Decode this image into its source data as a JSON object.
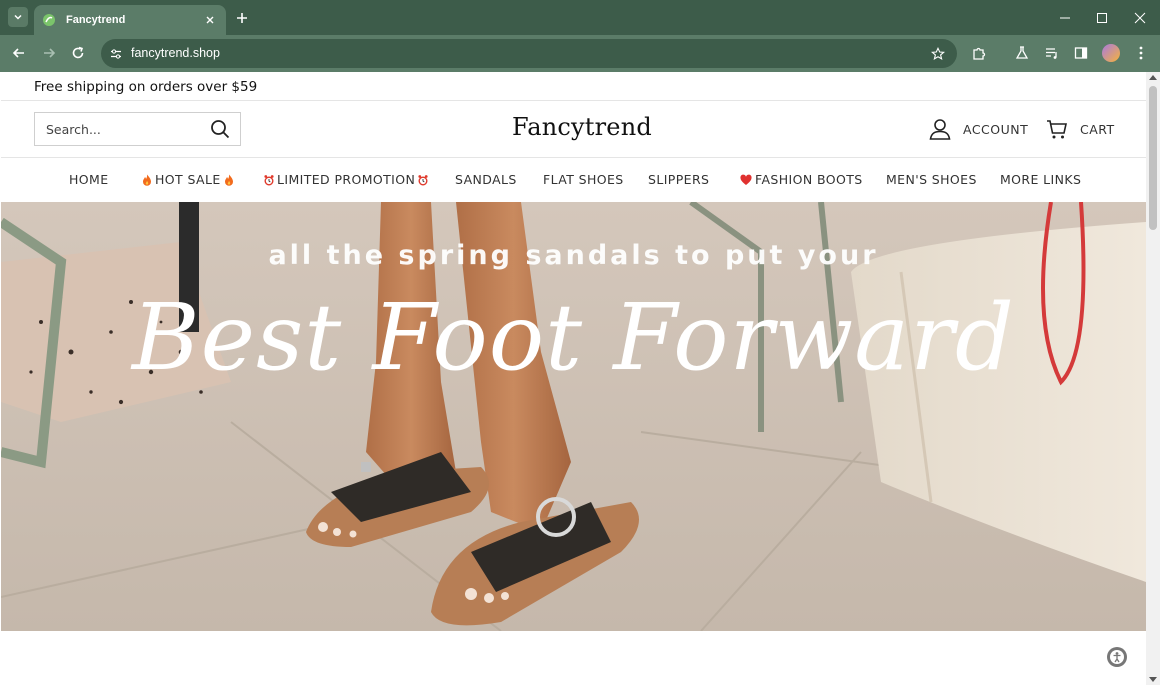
{
  "browser": {
    "tab_title": "Fancytrend",
    "url": "fancytrend.shop",
    "chrome_color": "#5b7c68"
  },
  "announcement": {
    "text": "Free shipping on orders over $59"
  },
  "header": {
    "search_placeholder": "Search...",
    "logo": "Fancytrend",
    "account_label": "ACCOUNT",
    "cart_label": "CART"
  },
  "nav": {
    "items": [
      {
        "label": "HOME"
      },
      {
        "label": "HOT SALE",
        "icon": "fire-icon"
      },
      {
        "label": "LIMITED PROMOTION",
        "icon": "alarm-clock-icon"
      },
      {
        "label": "SANDALS"
      },
      {
        "label": "FLAT SHOES"
      },
      {
        "label": "SLIPPERS"
      },
      {
        "label": "FASHION BOOTS",
        "icon": "heart-icon"
      },
      {
        "label": "MEN'S SHOES"
      },
      {
        "label": "MORE LINKS"
      }
    ]
  },
  "hero": {
    "subtitle": "all the spring sandals to put your",
    "title": "Best Foot Forward"
  }
}
